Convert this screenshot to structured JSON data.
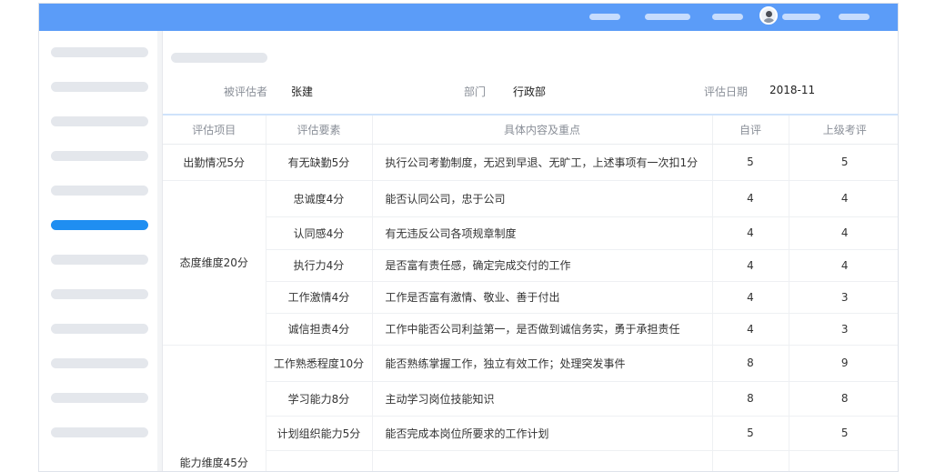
{
  "evaluation": {
    "employee_label": "被评估者",
    "employee_name": "张建",
    "department_label": "部门",
    "department_value": "行政部",
    "date_label": "评估日期",
    "date_value": "2018-11"
  },
  "table": {
    "headers": [
      "评估项目",
      "评估要素",
      "具体内容及重点",
      "自评",
      "上级考评"
    ],
    "categories": [
      "出勤情况5分",
      "态度维度20分",
      "能力维度45分"
    ],
    "rows": [
      {
        "element": "有无缺勤5分",
        "content": "执行公司考勤制度，无迟到早退、无旷工，上述事项有一次扣1分",
        "self": "5",
        "manager": "5"
      },
      {
        "element": "忠诚度4分",
        "content": "能否认同公司，忠于公司",
        "self": "4",
        "manager": "4"
      },
      {
        "element": "认同感4分",
        "content": "有无违反公司各项规章制度",
        "self": "4",
        "manager": "4"
      },
      {
        "element": "执行力4分",
        "content": "是否富有责任感，确定完成交付的工作",
        "self": "4",
        "manager": "4"
      },
      {
        "element": "工作激情4分",
        "content": "工作是否富有激情、敬业、善于付出",
        "self": "4",
        "manager": "3"
      },
      {
        "element": "诚信担责4分",
        "content": "工作中能否公司利益第一，是否做到诚信务实，勇于承担责任",
        "self": "4",
        "manager": "3"
      },
      {
        "element": "工作熟悉程度10分",
        "content": "能否熟练掌握工作，独立有效工作；处理突发事件",
        "self": "8",
        "manager": "9"
      },
      {
        "element": "学习能力8分",
        "content": "主动学习岗位技能知识",
        "self": "8",
        "manager": "8"
      },
      {
        "element": "计划组织能力5分",
        "content": "能否完成本岗位所要求的工作计划",
        "self": "5",
        "manager": "5"
      },
      {
        "element": "",
        "content": "",
        "self": "",
        "manager": ""
      }
    ]
  }
}
